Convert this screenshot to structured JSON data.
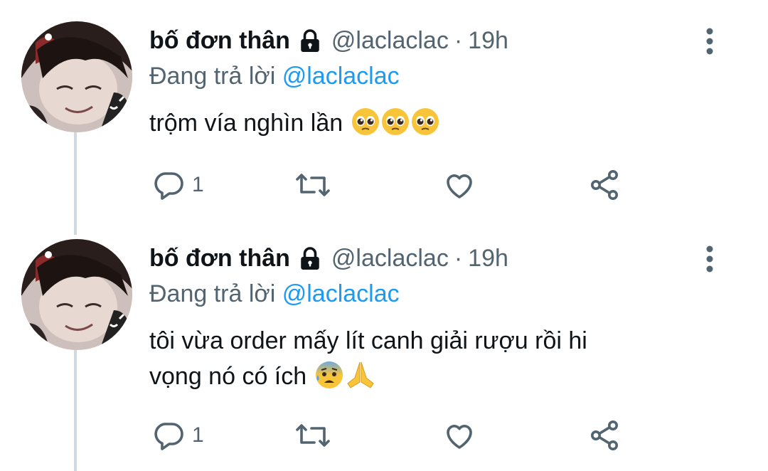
{
  "tweets": [
    {
      "author_name": "bố đơn thân",
      "handle": "@laclaclac",
      "separator": "·",
      "time": "19h",
      "reply_prefix": "Đang trả lời",
      "reply_mention": "@laclaclac",
      "text_lines": [
        "trộm vía nghìn lần"
      ],
      "emojis": [
        "pleading-face",
        "pleading-face",
        "pleading-face"
      ],
      "reply_count": "1",
      "icons": {
        "reply": "reply-icon",
        "retweet": "retweet-icon",
        "like": "heart-icon",
        "share": "share-icon",
        "more": "more-vertical-icon",
        "lock": "lock-icon"
      }
    },
    {
      "author_name": "bố đơn thân",
      "handle": "@laclaclac",
      "separator": "·",
      "time": "19h",
      "reply_prefix": "Đang trả lời",
      "reply_mention": "@laclaclac",
      "text_lines": [
        "tôi vừa order mấy lít canh giải rượu rồi hi",
        "vọng nó có ích"
      ],
      "emojis": [
        "anxious-face-with-sweat",
        "folded-hands"
      ],
      "reply_count": "1",
      "icons": {
        "reply": "reply-icon",
        "retweet": "retweet-icon",
        "like": "heart-icon",
        "share": "share-icon",
        "more": "more-vertical-icon",
        "lock": "lock-icon"
      }
    }
  ],
  "colors": {
    "link": "#1d9bf0",
    "secondary": "#536471",
    "thread_line": "#cfd9de",
    "text": "#0f1419"
  }
}
